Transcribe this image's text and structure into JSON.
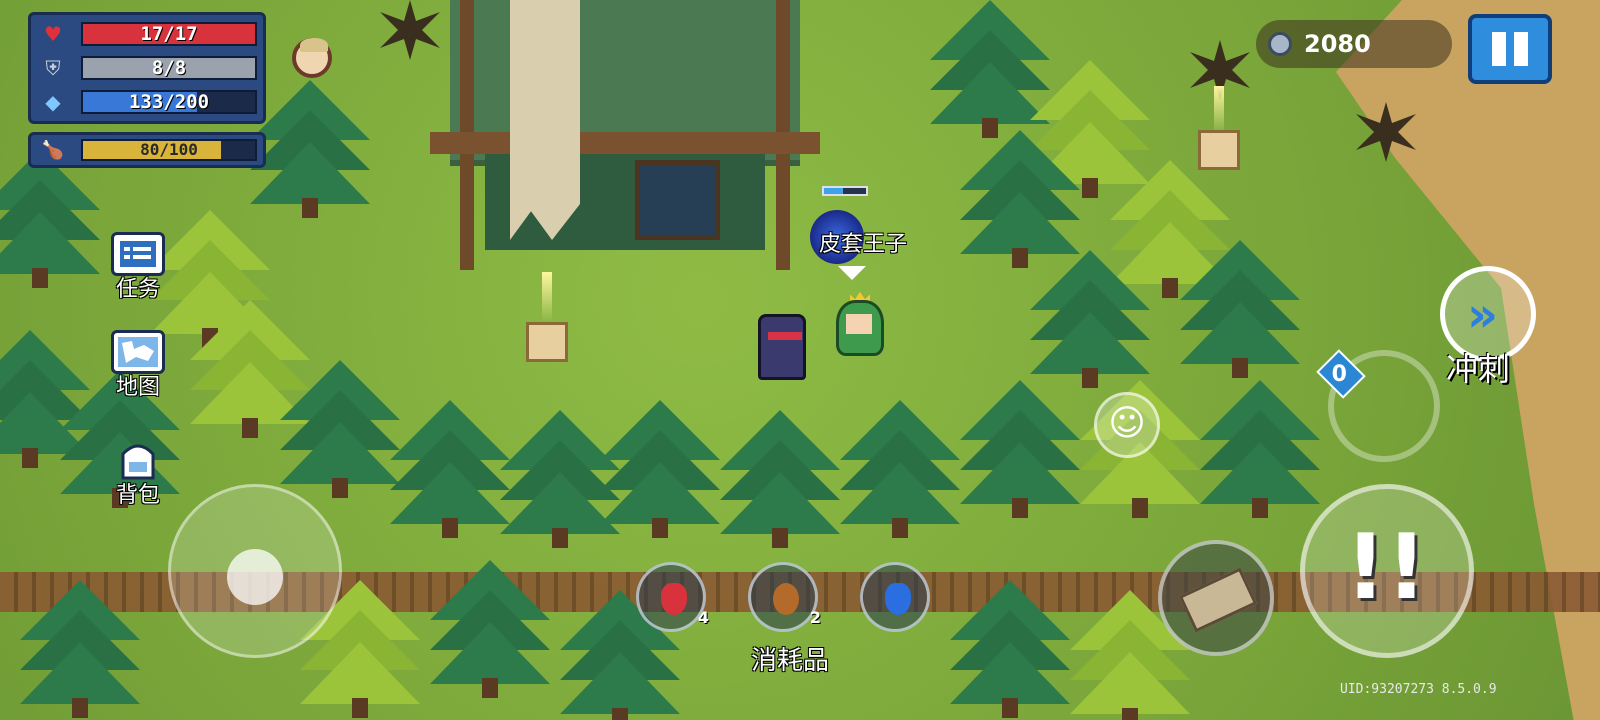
{
  "hud": {
    "hp": {
      "current": 17,
      "max": 17,
      "label": "17/17",
      "color": "#d8323c"
    },
    "armor": {
      "current": 8,
      "max": 8,
      "label": "8/8",
      "color": "#9aa3ad"
    },
    "energy": {
      "current": 133,
      "max": 200,
      "label": "133/200",
      "color": "#3a78d8"
    },
    "hunger": {
      "current": 80,
      "max": 100,
      "label": "80/100",
      "color": "#d9b43a"
    }
  },
  "currency": {
    "coins": "2080"
  },
  "side_menu": {
    "tasks": "任务",
    "map": "地图",
    "backpack": "背包"
  },
  "player": {
    "name": "皮套王子",
    "mini_bar_fraction": 0.45
  },
  "consumables": {
    "label": "消耗品",
    "items": [
      {
        "icon": "red-potion-icon",
        "count": "4",
        "color": "#d8323c"
      },
      {
        "icon": "meat-icon",
        "count": "2",
        "color": "#b46a2a"
      },
      {
        "icon": "blue-potion-icon",
        "count": "",
        "color": "#2a6ee0"
      }
    ]
  },
  "controls": {
    "dash_label": "冲刺",
    "skill_charges": "0"
  },
  "footer": {
    "uid": "UID:93207273 8.5.0.9"
  },
  "colors": {
    "panel": "#2b4a82",
    "accent_blue": "#2e8ddc"
  }
}
